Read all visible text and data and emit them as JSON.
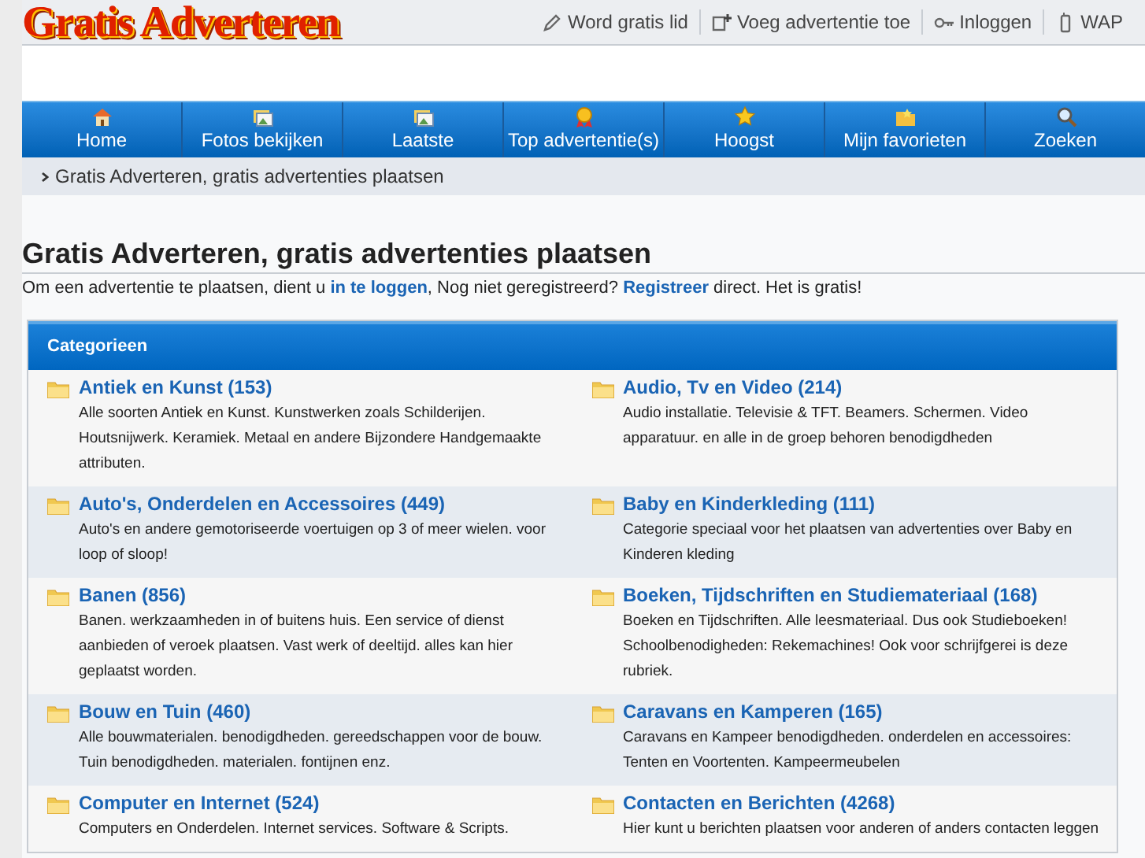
{
  "logo": "Gratis Adverteren",
  "top_links": [
    {
      "kind": "pencil",
      "label": "Word gratis lid"
    },
    {
      "kind": "add",
      "label": "Voeg advertentie toe"
    },
    {
      "kind": "key",
      "label": "Inloggen"
    },
    {
      "kind": "phone",
      "label": "WAP"
    }
  ],
  "nav": [
    {
      "kind": "home",
      "label": "Home"
    },
    {
      "kind": "photo",
      "label": "Fotos bekijken"
    },
    {
      "kind": "photo",
      "label": "Laatste"
    },
    {
      "kind": "badge",
      "label": "Top advertentie(s)"
    },
    {
      "kind": "star",
      "label": "Hoogst"
    },
    {
      "kind": "folder",
      "label": "Mijn favorieten"
    },
    {
      "kind": "search",
      "label": "Zoeken"
    }
  ],
  "breadcrumb": "Gratis Adverteren, gratis advertenties plaatsen",
  "heading": "Gratis Adverteren, gratis advertenties plaatsen",
  "intro": "Om een advertentie te plaatsen, dient u **in te loggen**, Nog niet geregistreerd? **Registreer** direct. Het is gratis!",
  "categories_title": "Categorieen",
  "categories": [
    {
      "title": "Antiek en Kunst (153)",
      "description": "Alle soorten Antiek en Kunst. Kunstwerken zoals Schilderijen. Houtsnijwerk. Keramiek. Metaal en andere Bijzondere Handgemaakte attributen."
    },
    {
      "title": "Audio, Tv en Video (214)",
      "description": "Audio installatie. Televisie & TFT. Beamers. Schermen. Video apparatuur. en alle in de groep behoren benodigdheden"
    },
    {
      "title": "Auto's, Onderdelen en Accessoires (449)",
      "description": "Auto's en andere gemotoriseerde voertuigen op 3 of meer wielen. voor loop of sloop!"
    },
    {
      "title": "Baby en Kinderkleding (111)",
      "description": "Categorie speciaal voor het plaatsen van advertenties over Baby en Kinderen kleding"
    },
    {
      "title": "Banen (856)",
      "description": "Banen. werkzaamheden in of buitens huis. Een service of dienst aanbieden of veroek plaatsen. Vast werk of deeltijd. alles kan hier geplaatst worden."
    },
    {
      "title": "Boeken, Tijdschriften en Studiemateriaal (168)",
      "description": "Boeken en Tijdschriften. Alle leesmateriaal. Dus ook Studieboeken! Schoolbenodigheden: Rekemachines! Ook voor schrijfgerei is deze rubriek."
    },
    {
      "title": "Bouw en Tuin (460)",
      "description": "Alle bouwmaterialen. benodigdheden. gereedschappen voor de bouw. Tuin benodigdheden. materialen. fontijnen enz."
    },
    {
      "title": "Caravans en Kamperen (165)",
      "description": "Caravans en Kampeer benodigdheden. onderdelen en accessoires: Tenten en Voortenten. Kampeermeubelen"
    },
    {
      "title": "Computer en Internet (524)",
      "description": "Computers en Onderdelen. Internet services. Software & Scripts."
    },
    {
      "title": "Contacten en Berichten (4268)",
      "description": "Hier kunt u berichten plaatsen voor anderen of anders contacten leggen"
    }
  ]
}
